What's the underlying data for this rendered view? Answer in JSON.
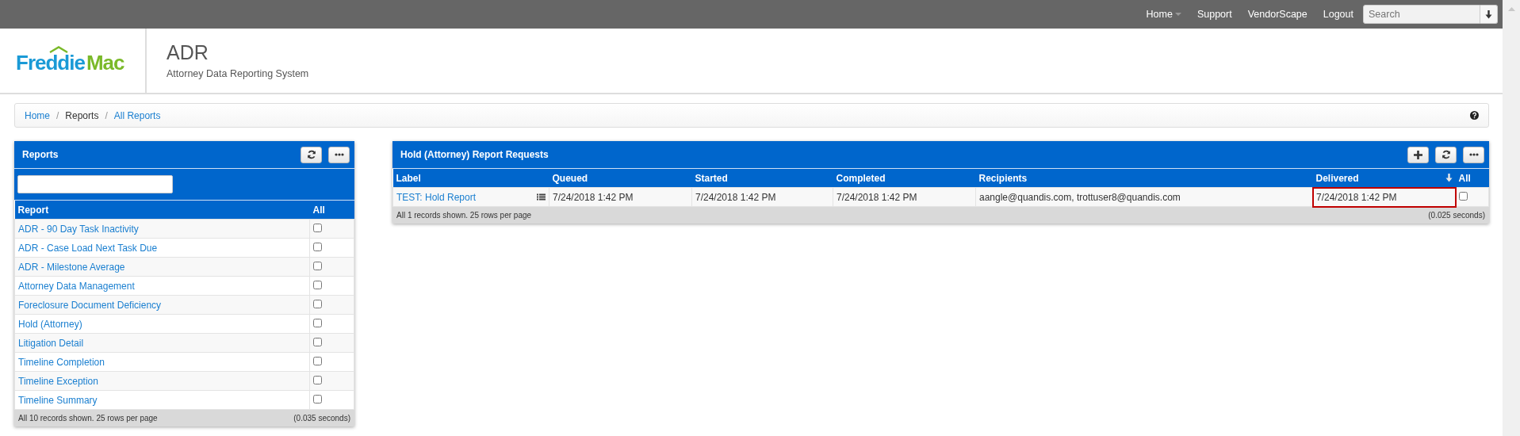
{
  "top_nav": {
    "links": [
      {
        "label": "Home",
        "has_dropdown": true
      },
      {
        "label": "Support",
        "has_dropdown": false
      },
      {
        "label": "VendorScape",
        "has_dropdown": false
      },
      {
        "label": "Logout",
        "has_dropdown": false
      }
    ],
    "search": {
      "placeholder": "Search"
    }
  },
  "header": {
    "logo": {
      "word_1": "Freddie",
      "word_2": "Mac"
    },
    "title": "ADR",
    "subtitle": "Attorney Data Reporting System"
  },
  "breadcrumb": [
    {
      "label": "Home",
      "link": true
    },
    {
      "separator_before": "/",
      "label": "Reports",
      "link": false
    },
    {
      "separator_before": "/",
      "label": "All Reports",
      "link": true
    }
  ],
  "reports_panel": {
    "title": "Reports",
    "columns": [
      "Report",
      "All"
    ],
    "rows": [
      {
        "name": "ADR - 90 Day Task Inactivity",
        "checked": false
      },
      {
        "name": "ADR - Case Load Next Task Due",
        "checked": false
      },
      {
        "name": "ADR - Milestone Average",
        "checked": false
      },
      {
        "name": "Attorney Data Management",
        "checked": false
      },
      {
        "name": "Foreclosure Document Deficiency",
        "checked": false
      },
      {
        "name": "Hold (Attorney)",
        "checked": false
      },
      {
        "name": "Litigation Detail",
        "checked": false
      },
      {
        "name": "Timeline Completion",
        "checked": false
      },
      {
        "name": "Timeline Exception",
        "checked": false
      },
      {
        "name": "Timeline Summary",
        "checked": false
      }
    ],
    "footer": {
      "summary": "All 10 records shown. 25 rows per page",
      "timing": "(0.035 seconds)"
    }
  },
  "requests_panel": {
    "title": "Hold (Attorney) Report Requests",
    "columns": [
      {
        "label": "Label",
        "sorted": false
      },
      {
        "label": "Queued",
        "sorted": false
      },
      {
        "label": "Started",
        "sorted": false
      },
      {
        "label": "Completed",
        "sorted": false
      },
      {
        "label": "Recipients",
        "sorted": false
      },
      {
        "label": "Delivered",
        "sorted": true
      },
      {
        "label": "All",
        "sorted": false
      }
    ],
    "rows": [
      {
        "label": "TEST: Hold Report",
        "queued": "7/24/2018 1:42 PM",
        "started": "7/24/2018 1:42 PM",
        "completed": "7/24/2018 1:42 PM",
        "recipients": "aangle@quandis.com, trottuser8@quandis.com",
        "delivered": "7/24/2018 1:42 PM",
        "delivered_highlighted": true,
        "checked": false
      }
    ],
    "footer": {
      "summary": "All 1 records shown. 25 rows per page",
      "timing": "(0.025 seconds)"
    }
  }
}
